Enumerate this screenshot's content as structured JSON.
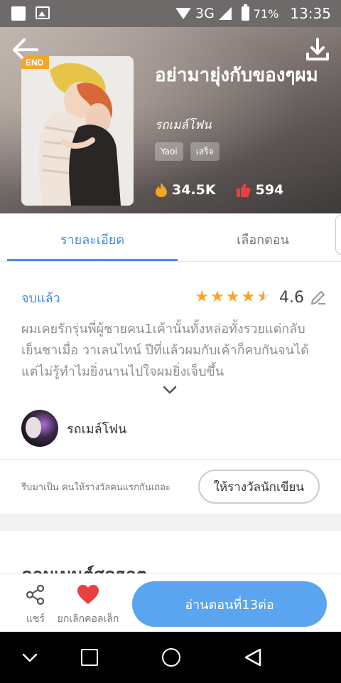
{
  "status_bar": {
    "network": "3G",
    "battery": "71%",
    "time": "13:35"
  },
  "header": {
    "end_badge": "END",
    "title": "อย่ามายุ่งกับของๆผม",
    "author": "รถเมล์โฟน",
    "tags": [
      "Yaoi",
      "เสร็จ"
    ],
    "views": "34.5K",
    "likes": "594"
  },
  "tabs": [
    {
      "label": "รายละเอียด"
    },
    {
      "label": "เลือกตอน"
    }
  ],
  "details": {
    "status": "จบแล้ว",
    "rating": "4.6",
    "stars": 4.5,
    "synopsis": "ผมเคยรักรุ่นพี่ผู้ชายคน1เค้านั้นทั้งหล่อทั้งรวยแต่กลับเย็นชาเมื่อ วาเลนไทน์ ปีที่แล้วผมกับเค้าก็คบกันจนได้ แต่ไม่รู้ทำไมยิ่งนานไปใจผมยิ่งเจ็บขึ้น"
  },
  "author_row": {
    "name": "รถเมล์โฟน"
  },
  "reward": {
    "text": "รีบมาเป็น คนให้รางวัลคนแรกกันเถอะ",
    "button": "ให้รางวัลนักเขียน"
  },
  "section_title": "คอมเมนต์สุดฮอต",
  "actions": {
    "share": "แชร์",
    "favorite": "ยกเลิกคอลเล็ก",
    "read": "อ่านตอนที่13ต่อ"
  },
  "colors": {
    "accent": "#4a90e2",
    "star": "#f5a623",
    "read_button": "#5ba4ef",
    "heart": "#e8413f"
  }
}
